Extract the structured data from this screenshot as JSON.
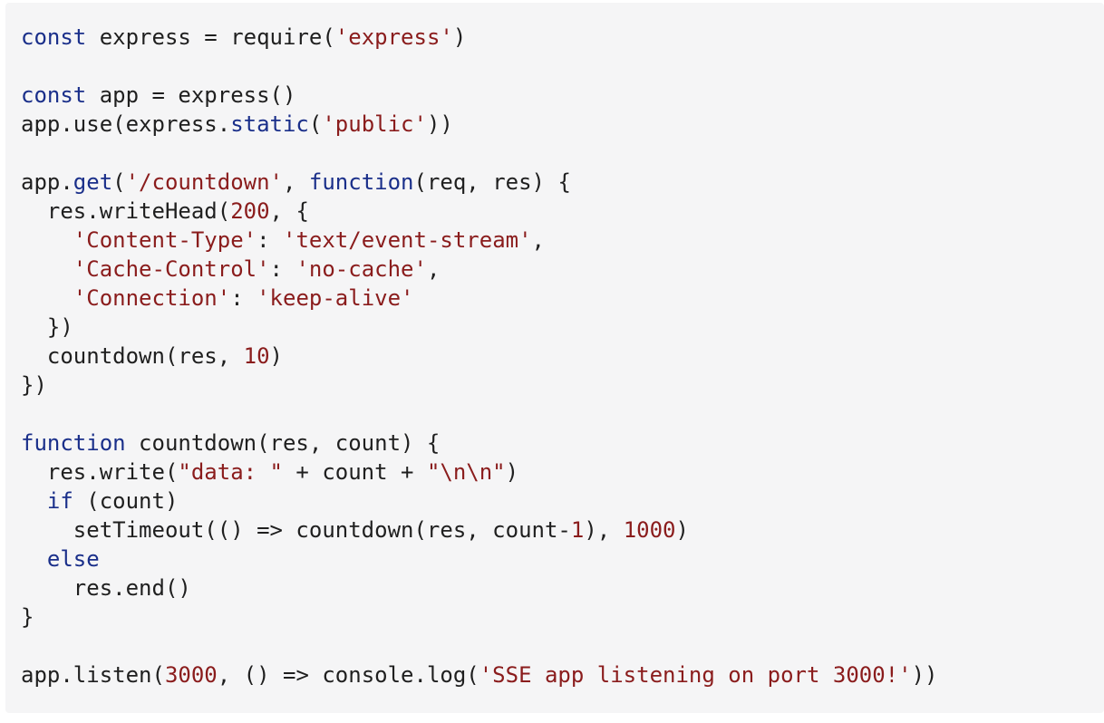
{
  "colors": {
    "background": "#f5f5f6",
    "plain": "#1f1f1f",
    "keyword": "#1a2f8a",
    "string": "#8a1c1c",
    "number": "#8a1c1c"
  },
  "code": {
    "language": "javascript",
    "lines": [
      [
        {
          "t": "kw",
          "v": "const"
        },
        {
          "t": "p",
          "v": " express = require("
        },
        {
          "t": "s",
          "v": "'express'"
        },
        {
          "t": "p",
          "v": ")"
        }
      ],
      [],
      [
        {
          "t": "kw",
          "v": "const"
        },
        {
          "t": "p",
          "v": " app = express()"
        }
      ],
      [
        {
          "t": "p",
          "v": "app.use(express."
        },
        {
          "t": "kw",
          "v": "static"
        },
        {
          "t": "p",
          "v": "("
        },
        {
          "t": "s",
          "v": "'public'"
        },
        {
          "t": "p",
          "v": "))"
        }
      ],
      [],
      [
        {
          "t": "p",
          "v": "app."
        },
        {
          "t": "kw",
          "v": "get"
        },
        {
          "t": "p",
          "v": "("
        },
        {
          "t": "s",
          "v": "'/countdown'"
        },
        {
          "t": "p",
          "v": ", "
        },
        {
          "t": "kw",
          "v": "function"
        },
        {
          "t": "p",
          "v": "(req, res) {"
        }
      ],
      [
        {
          "t": "p",
          "v": "  res.writeHead("
        },
        {
          "t": "n",
          "v": "200"
        },
        {
          "t": "p",
          "v": ", {"
        }
      ],
      [
        {
          "t": "p",
          "v": "    "
        },
        {
          "t": "s",
          "v": "'Content-Type'"
        },
        {
          "t": "p",
          "v": ": "
        },
        {
          "t": "s",
          "v": "'text/event-stream'"
        },
        {
          "t": "p",
          "v": ","
        }
      ],
      [
        {
          "t": "p",
          "v": "    "
        },
        {
          "t": "s",
          "v": "'Cache-Control'"
        },
        {
          "t": "p",
          "v": ": "
        },
        {
          "t": "s",
          "v": "'no-cache'"
        },
        {
          "t": "p",
          "v": ","
        }
      ],
      [
        {
          "t": "p",
          "v": "    "
        },
        {
          "t": "s",
          "v": "'Connection'"
        },
        {
          "t": "p",
          "v": ": "
        },
        {
          "t": "s",
          "v": "'keep-alive'"
        }
      ],
      [
        {
          "t": "p",
          "v": "  })"
        }
      ],
      [
        {
          "t": "p",
          "v": "  countdown(res, "
        },
        {
          "t": "n",
          "v": "10"
        },
        {
          "t": "p",
          "v": ")"
        }
      ],
      [
        {
          "t": "p",
          "v": "})"
        }
      ],
      [],
      [
        {
          "t": "kw",
          "v": "function"
        },
        {
          "t": "p",
          "v": " countdown(res, count) {"
        }
      ],
      [
        {
          "t": "p",
          "v": "  res.write("
        },
        {
          "t": "s",
          "v": "\"data: \""
        },
        {
          "t": "p",
          "v": " + count + "
        },
        {
          "t": "s",
          "v": "\"\\n\\n\""
        },
        {
          "t": "p",
          "v": ")"
        }
      ],
      [
        {
          "t": "p",
          "v": "  "
        },
        {
          "t": "kw",
          "v": "if"
        },
        {
          "t": "p",
          "v": " (count)"
        }
      ],
      [
        {
          "t": "p",
          "v": "    setTimeout(() => countdown(res, count-"
        },
        {
          "t": "n",
          "v": "1"
        },
        {
          "t": "p",
          "v": "), "
        },
        {
          "t": "n",
          "v": "1000"
        },
        {
          "t": "p",
          "v": ")"
        }
      ],
      [
        {
          "t": "p",
          "v": "  "
        },
        {
          "t": "kw",
          "v": "else"
        }
      ],
      [
        {
          "t": "p",
          "v": "    res.end()"
        }
      ],
      [
        {
          "t": "p",
          "v": "}"
        }
      ],
      [],
      [
        {
          "t": "p",
          "v": "app.listen("
        },
        {
          "t": "n",
          "v": "3000"
        },
        {
          "t": "p",
          "v": ", () => console.log("
        },
        {
          "t": "s",
          "v": "'SSE app listening on port 3000!'"
        },
        {
          "t": "p",
          "v": "))"
        }
      ]
    ]
  }
}
